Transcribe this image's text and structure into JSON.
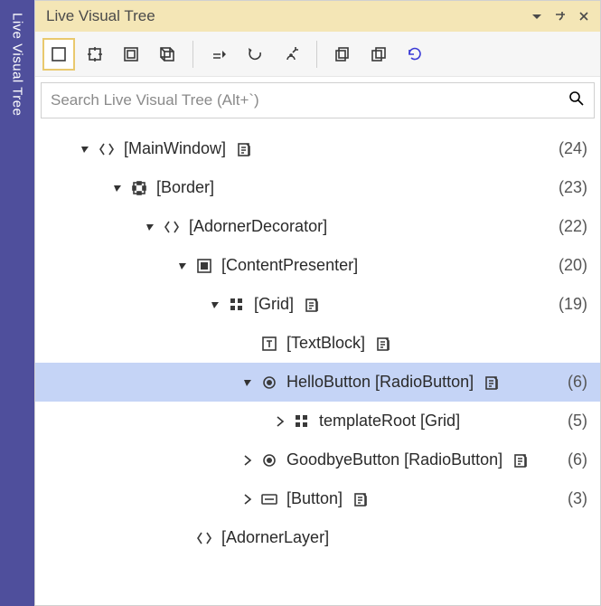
{
  "sideTab": {
    "label": "Live Visual Tree"
  },
  "titlebar": {
    "title": "Live Visual Tree"
  },
  "toolbar": {
    "items": [
      {
        "id": "select-element",
        "selected": true
      },
      {
        "id": "show-layout-adorners"
      },
      {
        "id": "track-focused"
      },
      {
        "id": "toggle-2d"
      },
      {
        "sep": true
      },
      {
        "id": "go-to-live"
      },
      {
        "id": "undo"
      },
      {
        "id": "options"
      },
      {
        "sep": true
      },
      {
        "id": "collapse-all"
      },
      {
        "id": "expand-all"
      },
      {
        "id": "refresh",
        "accent": true
      }
    ]
  },
  "search": {
    "placeholder": "Search Live Visual Tree (Alt+`)"
  },
  "tree": [
    {
      "depth": 0,
      "expand": "open",
      "icon": "element",
      "label": "[MainWindow]",
      "badge": true,
      "count": "(24)"
    },
    {
      "depth": 1,
      "expand": "open",
      "icon": "border",
      "label": "[Border]",
      "badge": false,
      "count": "(23)"
    },
    {
      "depth": 2,
      "expand": "open",
      "icon": "element",
      "label": "[AdornerDecorator]",
      "badge": false,
      "count": "(22)"
    },
    {
      "depth": 3,
      "expand": "open",
      "icon": "content",
      "label": "[ContentPresenter]",
      "badge": false,
      "count": "(20)"
    },
    {
      "depth": 4,
      "expand": "open",
      "icon": "grid",
      "label": "[Grid]",
      "badge": true,
      "count": "(19)"
    },
    {
      "depth": 5,
      "expand": "none",
      "icon": "text",
      "label": "[TextBlock]",
      "badge": true,
      "count": ""
    },
    {
      "depth": 5,
      "expand": "open",
      "icon": "radio",
      "label": "HelloButton [RadioButton]",
      "badge": true,
      "count": "(6)",
      "selected": true
    },
    {
      "depth": 6,
      "expand": "closed",
      "icon": "grid",
      "label": "templateRoot [Grid]",
      "badge": false,
      "count": "(5)"
    },
    {
      "depth": 5,
      "expand": "closed",
      "icon": "radio",
      "label": "GoodbyeButton [RadioButton]",
      "badge": true,
      "count": "(6)"
    },
    {
      "depth": 5,
      "expand": "closed",
      "icon": "button",
      "label": "[Button]",
      "badge": true,
      "count": "(3)"
    },
    {
      "depth": 3,
      "expand": "none",
      "icon": "element",
      "label": "[AdornerLayer]",
      "badge": false,
      "count": ""
    }
  ]
}
